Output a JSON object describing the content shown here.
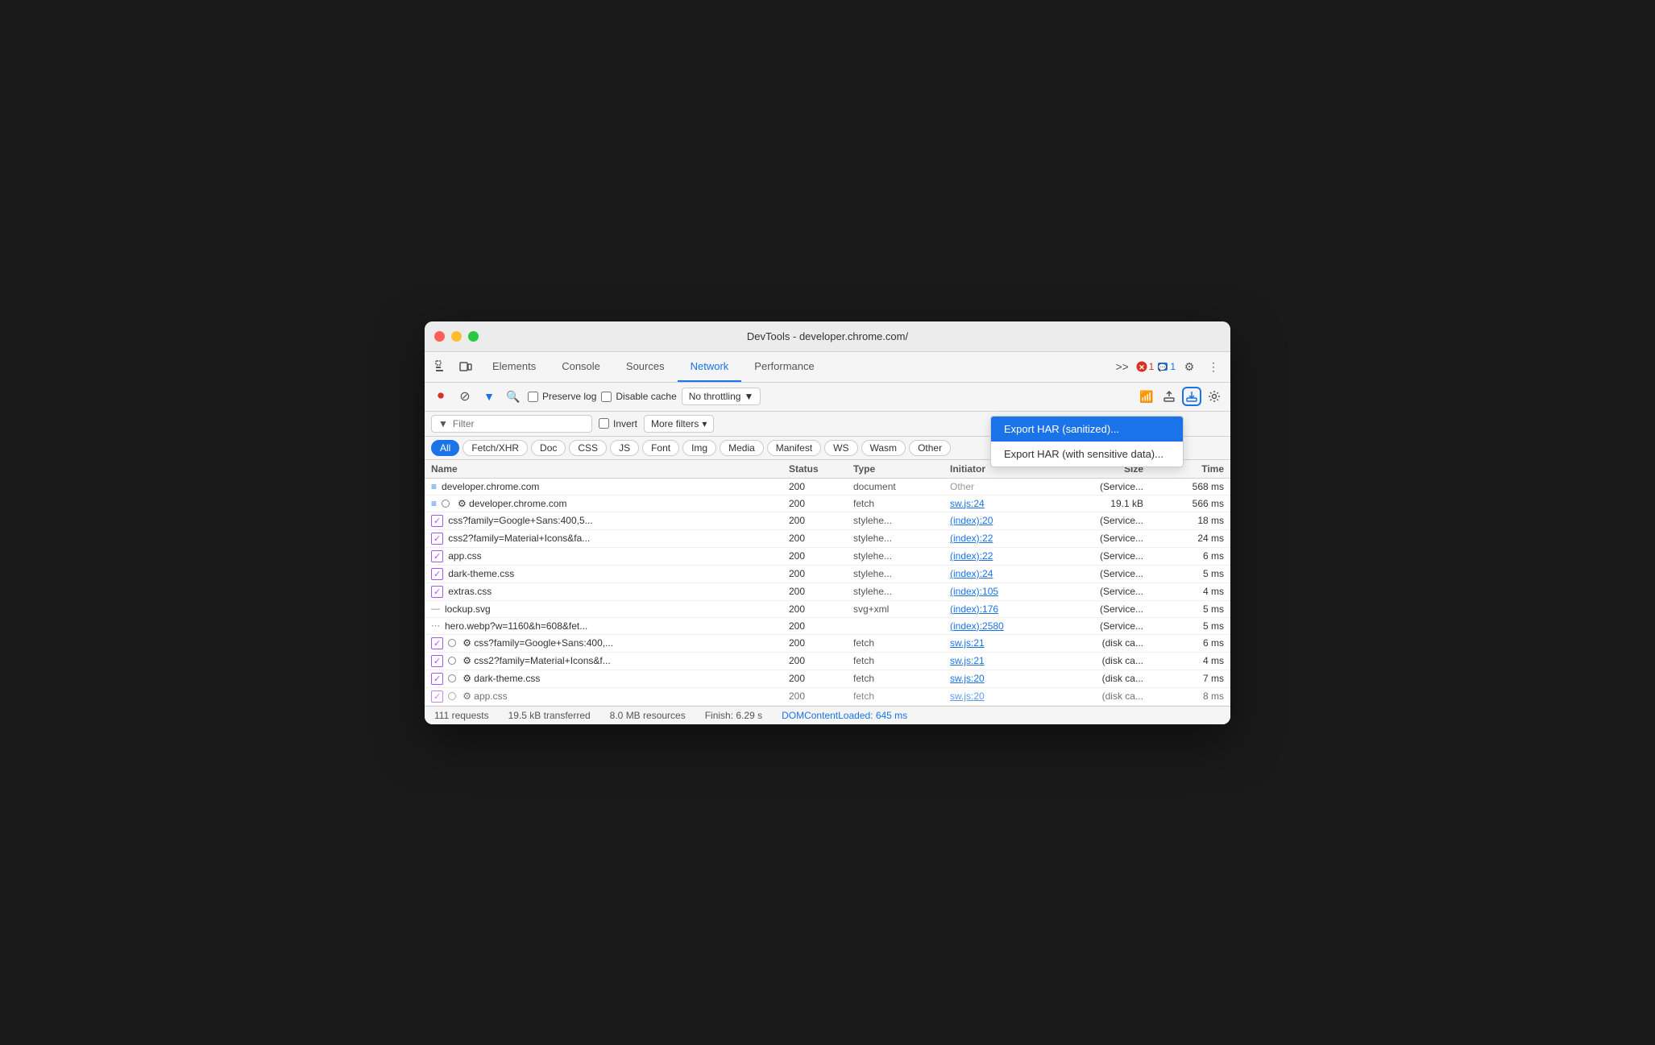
{
  "window": {
    "title": "DevTools - developer.chrome.com/"
  },
  "tabs": [
    {
      "label": "Elements",
      "active": false
    },
    {
      "label": "Console",
      "active": false
    },
    {
      "label": "Sources",
      "active": false
    },
    {
      "label": "Network",
      "active": true
    },
    {
      "label": "Performance",
      "active": false
    }
  ],
  "toolbar": {
    "error_count": "1",
    "warn_count": "1",
    "more_tabs": ">>",
    "settings_label": "⚙",
    "more_label": "⋮"
  },
  "network_toolbar": {
    "preserve_log": "Preserve log",
    "disable_cache": "Disable cache",
    "throttle_value": "No throttling",
    "throttle_arrow": "▼"
  },
  "filter": {
    "placeholder": "Filter",
    "invert": "Invert",
    "more_filters": "More filters",
    "more_arrow": "▾"
  },
  "type_filters": [
    "All",
    "Fetch/XHR",
    "Doc",
    "CSS",
    "JS",
    "Font",
    "Img",
    "Media",
    "Manifest",
    "WS",
    "Wasm",
    "Other"
  ],
  "table": {
    "headers": [
      "Name",
      "Status",
      "Type",
      "Initiator",
      "Size",
      "Time"
    ],
    "rows": [
      {
        "name": "developer.chrome.com",
        "icon": "doc",
        "status": "200",
        "type": "document",
        "initiator": "Other",
        "initiator_link": false,
        "size": "(Service...",
        "time": "568 ms"
      },
      {
        "name": "⚙ developer.chrome.com",
        "icon": "doc",
        "status": "200",
        "type": "fetch",
        "initiator": "sw.js:24",
        "initiator_link": true,
        "size": "19.1 kB",
        "time": "566 ms"
      },
      {
        "name": "css?family=Google+Sans:400,5...",
        "icon": "css",
        "status": "200",
        "type": "stylehe...",
        "initiator": "(index):20",
        "initiator_link": true,
        "size": "(Service...",
        "time": "18 ms"
      },
      {
        "name": "css2?family=Material+Icons&fa...",
        "icon": "css",
        "status": "200",
        "type": "stylehe...",
        "initiator": "(index):22",
        "initiator_link": true,
        "size": "(Service...",
        "time": "24 ms"
      },
      {
        "name": "app.css",
        "icon": "css",
        "status": "200",
        "type": "stylehe...",
        "initiator": "(index):22",
        "initiator_link": true,
        "size": "(Service...",
        "time": "6 ms"
      },
      {
        "name": "dark-theme.css",
        "icon": "css",
        "status": "200",
        "type": "stylehe...",
        "initiator": "(index):24",
        "initiator_link": true,
        "size": "(Service...",
        "time": "5 ms"
      },
      {
        "name": "extras.css",
        "icon": "css",
        "status": "200",
        "type": "stylehe...",
        "initiator": "(index):105",
        "initiator_link": true,
        "size": "(Service...",
        "time": "4 ms"
      },
      {
        "name": "lockup.svg",
        "icon": "img",
        "status": "200",
        "type": "svg+xml",
        "initiator": "(index):176",
        "initiator_link": true,
        "size": "(Service...",
        "time": "5 ms"
      },
      {
        "name": "hero.webp?w=1160&h=608&fet...",
        "icon": "img2",
        "status": "200",
        "type": "",
        "initiator": "(index):2580",
        "initiator_link": true,
        "size": "(Service...",
        "time": "5 ms"
      },
      {
        "name": "⚙ css?family=Google+Sans:400,...",
        "icon": "css",
        "status": "200",
        "type": "fetch",
        "initiator": "sw.js:21",
        "initiator_link": true,
        "size": "(disk ca...",
        "time": "6 ms"
      },
      {
        "name": "⚙ css2?family=Material+Icons&f...",
        "icon": "css",
        "status": "200",
        "type": "fetch",
        "initiator": "sw.js:21",
        "initiator_link": true,
        "size": "(disk ca...",
        "time": "4 ms"
      },
      {
        "name": "⚙ dark-theme.css",
        "icon": "css",
        "status": "200",
        "type": "fetch",
        "initiator": "sw.js:20",
        "initiator_link": true,
        "size": "(disk ca...",
        "time": "7 ms"
      },
      {
        "name": "⚙ app.css",
        "icon": "css",
        "status": "200",
        "type": "fetch",
        "initiator": "sw.js:20",
        "initiator_link": true,
        "size": "(disk ca...",
        "time": "8 ms"
      }
    ]
  },
  "status_bar": {
    "requests": "111 requests",
    "transferred": "19.5 kB transferred",
    "resources": "8.0 MB resources",
    "finish": "Finish: 6.29 s",
    "dom_loaded": "DOMContentLoaded: 645 ms"
  },
  "dropdown": {
    "export_har_sanitized": "Export HAR (sanitized)...",
    "export_har_sensitive": "Export HAR (with sensitive data)..."
  },
  "colors": {
    "active_tab": "#1a73e8",
    "link": "#1a73e8",
    "dom_loaded": "#1a73e8"
  }
}
